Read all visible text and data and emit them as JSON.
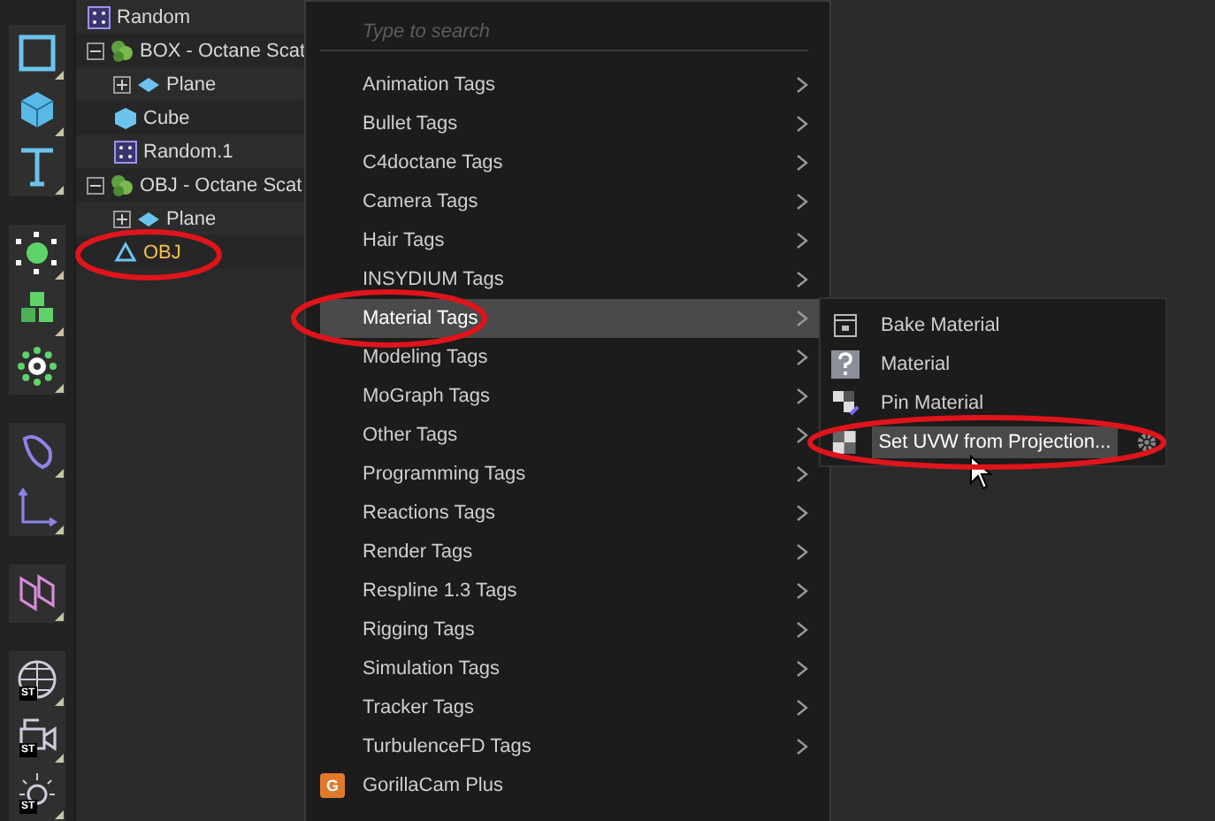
{
  "toolbar": {
    "badges": [
      "ST",
      "ST",
      "ST"
    ]
  },
  "tree": [
    {
      "name": "Random",
      "kind": "random",
      "selected": false
    },
    {
      "name": "BOX - Octane Scat",
      "kind": "scatter",
      "selected": false,
      "expanded": true,
      "children": [
        {
          "name": "Plane",
          "kind": "plane",
          "selected": false,
          "expanded": false
        },
        {
          "name": "Cube",
          "kind": "cube",
          "selected": false
        },
        {
          "name": "Random.1",
          "kind": "random",
          "selected": false
        }
      ]
    },
    {
      "name": "OBJ - Octane Scat",
      "kind": "scatter",
      "selected": false,
      "expanded": true,
      "children": [
        {
          "name": "Plane",
          "kind": "plane",
          "selected": false,
          "expanded": false
        },
        {
          "name": "OBJ",
          "kind": "null",
          "selected": true
        }
      ]
    }
  ],
  "menu": {
    "search": {
      "placeholder": "Type to search"
    },
    "items": [
      {
        "kind": "category",
        "label": "Animation Tags",
        "selected": false
      },
      {
        "kind": "category",
        "label": "Bullet Tags",
        "selected": false
      },
      {
        "kind": "category",
        "label": "C4doctane Tags",
        "selected": false
      },
      {
        "kind": "category",
        "label": "Camera Tags",
        "selected": false
      },
      {
        "kind": "category",
        "label": "Hair Tags",
        "selected": false
      },
      {
        "kind": "category",
        "label": "INSYDIUM Tags",
        "selected": false
      },
      {
        "kind": "category",
        "label": "Material Tags",
        "selected": true
      },
      {
        "kind": "category",
        "label": "Modeling Tags",
        "selected": false
      },
      {
        "kind": "category",
        "label": "MoGraph Tags",
        "selected": false
      },
      {
        "kind": "category",
        "label": "Other Tags",
        "selected": false
      },
      {
        "kind": "category",
        "label": "Programming Tags",
        "selected": false
      },
      {
        "kind": "category",
        "label": "Reactions Tags",
        "selected": false
      },
      {
        "kind": "category",
        "label": "Render Tags",
        "selected": false
      },
      {
        "kind": "category",
        "label": "Respline 1.3 Tags",
        "selected": false
      },
      {
        "kind": "category",
        "label": "Rigging Tags",
        "selected": false
      },
      {
        "kind": "category",
        "label": "Simulation Tags",
        "selected": false
      },
      {
        "kind": "category",
        "label": "Tracker Tags",
        "selected": false
      },
      {
        "kind": "category",
        "label": "TurbulenceFD Tags",
        "selected": false
      },
      {
        "kind": "plugin",
        "label": "GorillaCam Plus",
        "icon_text": "G",
        "selected": false
      }
    ]
  },
  "submenu": {
    "items": [
      {
        "label": "Bake Material",
        "kind": "bake",
        "selected": false,
        "has_settings": false
      },
      {
        "label": "Material",
        "kind": "question",
        "selected": false,
        "has_settings": false
      },
      {
        "label": "Pin Material",
        "kind": "pin",
        "selected": false,
        "has_settings": false
      },
      {
        "label": "Set UVW from Projection...",
        "kind": "checker",
        "selected": true,
        "has_settings": true
      }
    ]
  }
}
